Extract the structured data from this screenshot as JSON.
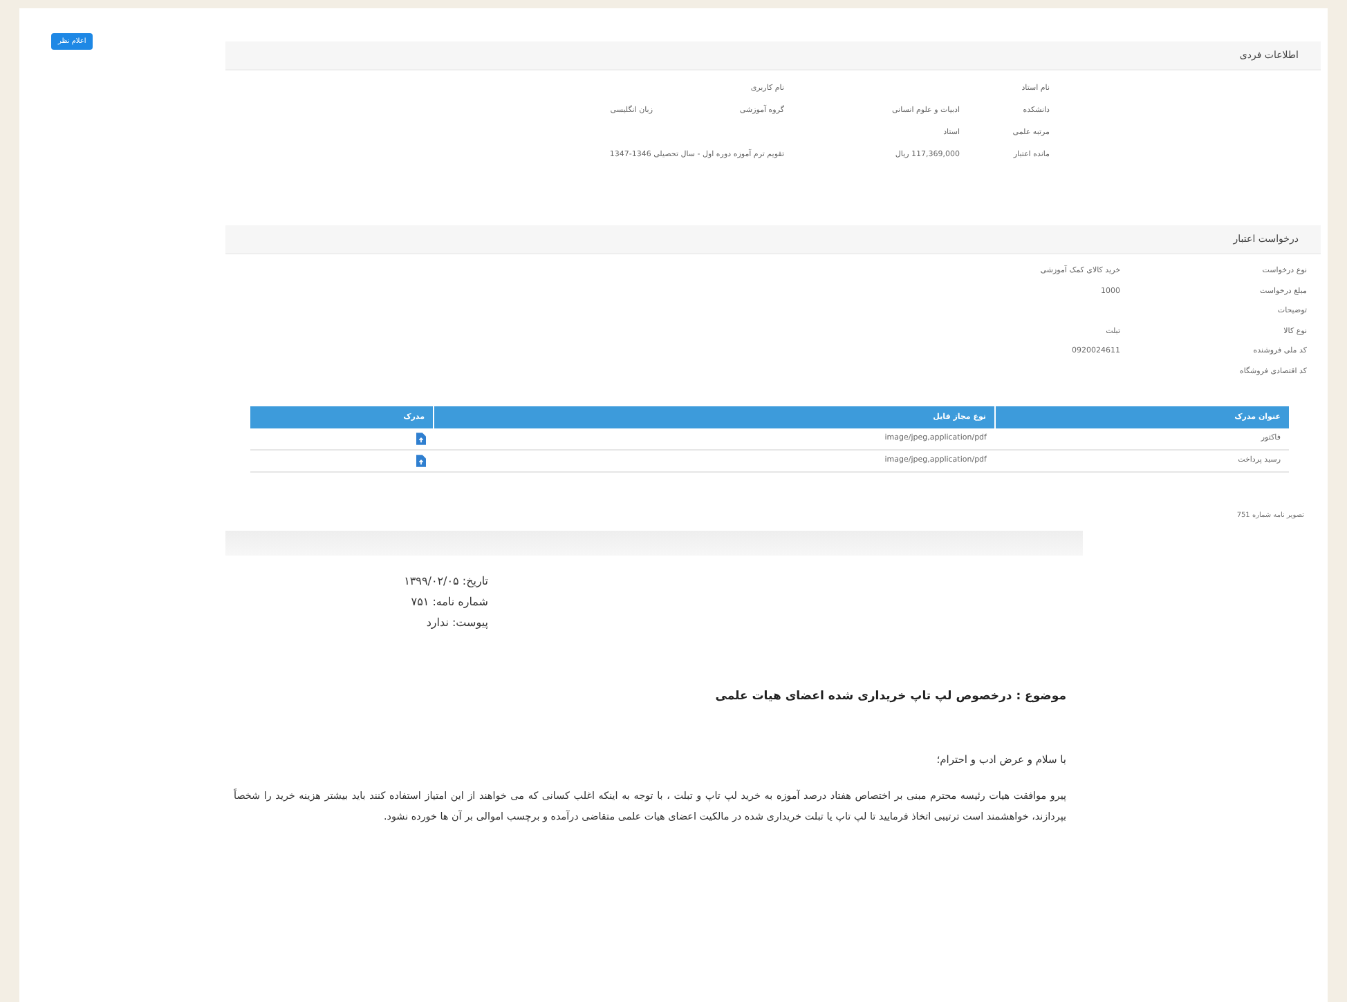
{
  "action_button": "اعلام نظر",
  "personal_info": {
    "title": "اطلاعات فردی",
    "rows": [
      [
        {
          "label": "نام استاد"
        },
        {
          "label": "نام کاربری"
        }
      ],
      [
        {
          "label": "دانشکده",
          "value": "ادبیات و علوم انسانی"
        },
        {
          "label": "گروه آموزشی",
          "value": "زبان انگلیسی"
        }
      ],
      [
        {
          "label": "مرتبه علمی",
          "value": "استاد"
        }
      ],
      [
        {
          "label": "مانده اعتبار",
          "value": "117,369,000 ریال"
        },
        {
          "label": "تقویم ترم آموزه دوره اول - سال تحصیلی 1346-1347"
        }
      ]
    ]
  },
  "credit_request": {
    "title": "درخواست اعتبار",
    "fields": [
      {
        "label": "نوع درخواست",
        "value": "خرید کالای کمک آموزشی"
      },
      {
        "label": "مبلغ درخواست",
        "value": "1000"
      },
      {
        "label": "توضیحات"
      },
      {
        "label": "نوع کالا",
        "value": "تبلت"
      },
      {
        "label": "کد ملی فروشنده",
        "value": "0920024611"
      },
      {
        "label": "کد اقتصادی فروشگاه"
      }
    ]
  },
  "documents": {
    "columns": [
      "عنوان مدرک",
      "نوع مجاز فایل",
      "مدرک"
    ],
    "rows": [
      {
        "title": "فاکتور",
        "types": "image/jpeg,application/pdf"
      },
      {
        "title": "رسید پرداخت",
        "types": "image/jpeg,application/pdf"
      }
    ]
  },
  "letter_caption": "تصویر نامه شماره 751",
  "letter": {
    "meta": [
      "تاریخ: ۱۳۹۹/۰۲/۰۵",
      "شماره نامه: ۷۵۱",
      "پیوست: ندارد"
    ],
    "subject": "موضوع : درخصوص لپ تاپ خریداری شده اعضای هیات علمی",
    "greeting": "با سلام و عرض ادب و احترام؛",
    "body": "پیرو موافقت هیات رئیسه محترم مبنی بر اختصاص هفتاد درصد آموزه به خرید لپ تاپ و تبلت ، با توجه به اینکه اغلب کسانی که می خواهند از این امتیاز استفاده کنند باید بیشتر هزینه خرید را شخصاً بپردازند، خواهشمند است ترتیبی اتخاذ فرمایید تا لپ تاپ یا تبلت خریداری شده در مالکیت اعضای هیات علمی متقاضی درآمده و برچسب اموالی بر آن ها خورده نشود."
  }
}
